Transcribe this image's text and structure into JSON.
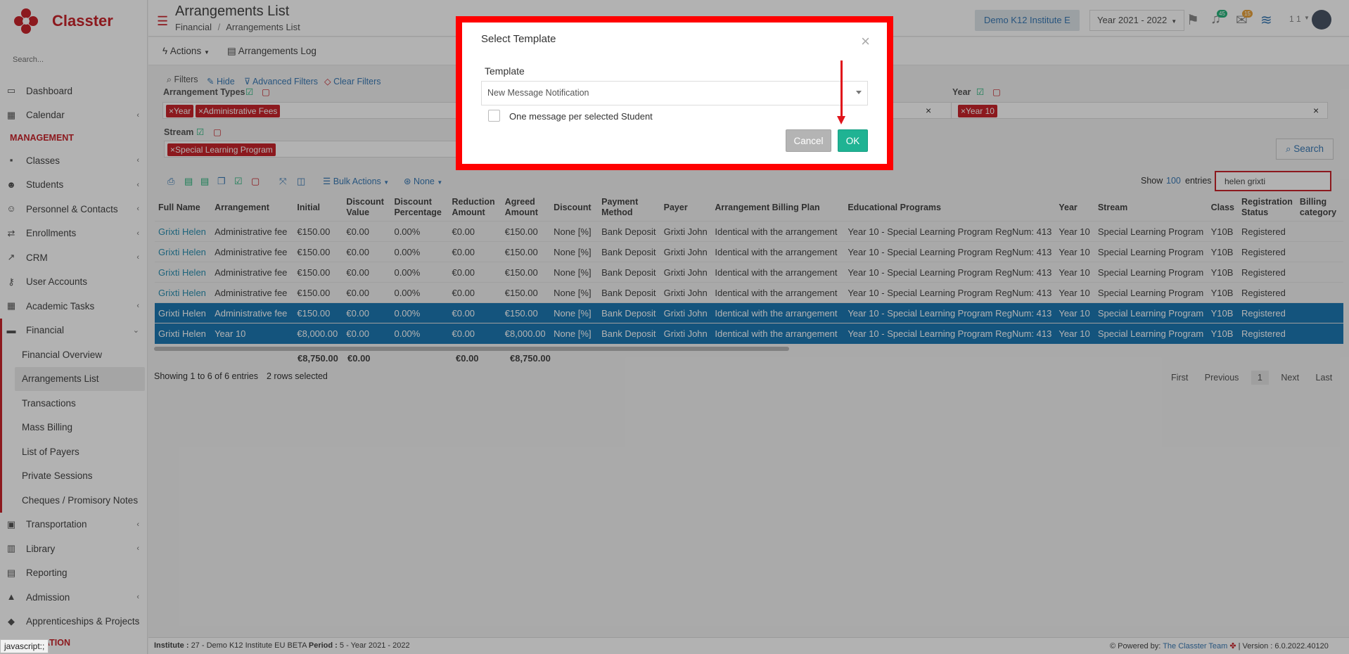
{
  "app": {
    "name": "Classter",
    "search_placeholder": "Search..."
  },
  "nav": {
    "dashboard": "Dashboard",
    "calendar": "Calendar",
    "management": "MANAGEMENT",
    "classes": "Classes",
    "students": "Students",
    "personnel": "Personnel & Contacts",
    "enrollments": "Enrollments",
    "crm": "CRM",
    "user_accounts": "User Accounts",
    "academic_tasks": "Academic Tasks",
    "financial": "Financial",
    "financial_overview": "Financial Overview",
    "arrangements_list": "Arrangements List",
    "transactions": "Transactions",
    "mass_billing": "Mass Billing",
    "list_of_payers": "List of Payers",
    "private_sessions": "Private Sessions",
    "cheques": "Cheques / Promisory Notes",
    "transportation": "Transportation",
    "library": "Library",
    "reporting": "Reporting",
    "admission": "Admission",
    "apprenticeships": "Apprenticeships & Projects",
    "configuration_partial": "URATION"
  },
  "header": {
    "title": "Arrangements List",
    "breadcrumb_1": "Financial",
    "breadcrumb_sep": "/",
    "breadcrumb_2": "Arrangements List",
    "institute": "Demo K12 Institute E",
    "year": "Year 2021 - 2022",
    "notif_count_1": "45",
    "notif_count_2": "15",
    "user_short": "1 1"
  },
  "toolbar": {
    "actions": "Actions",
    "log": "Arrangements Log"
  },
  "filters": {
    "filters": "Filters",
    "hide": "Hide",
    "advanced": "Advanced Filters",
    "clear": "Clear Filters",
    "arr_types_label": "Arrangement Types",
    "tag_year": "Year",
    "tag_admin": "Administrative Fees",
    "year_label": "Year",
    "tag_year10": "Year 10",
    "stream_label": "Stream",
    "tag_stream": "Special Learning Program",
    "search_btn": "Search",
    "tag_x": "×",
    "close_x": "×"
  },
  "table_controls": {
    "bulk": "Bulk Actions",
    "none": "None",
    "show": "Show",
    "entries_count": "100",
    "entries": "entries",
    "search_value": "helen grixti"
  },
  "table": {
    "headers": [
      "Full Name",
      "Arrangement",
      "Initial",
      "Discount Value",
      "Discount Percentage",
      "Reduction Amount",
      "Agreed Amount",
      "Discount",
      "Payment Method",
      "Payer",
      "Arrangement Billing Plan",
      "Educational Programs",
      "Year",
      "Stream",
      "Class",
      "Registration Status",
      "Billing category"
    ],
    "rows": [
      [
        "Grixti Helen",
        "Administrative fee",
        "€150.00",
        "€0.00",
        "0.00%",
        "€0.00",
        "€150.00",
        "None [%]",
        "Bank Deposit",
        "Grixti John",
        "Identical with the arrangement",
        "Year 10 - Special Learning Program RegNum: 413",
        "Year 10",
        "Special Learning Program",
        "Y10B",
        "Registered",
        ""
      ],
      [
        "Grixti Helen",
        "Administrative fee",
        "€150.00",
        "€0.00",
        "0.00%",
        "€0.00",
        "€150.00",
        "None [%]",
        "Bank Deposit",
        "Grixti John",
        "Identical with the arrangement",
        "Year 10 - Special Learning Program RegNum: 413",
        "Year 10",
        "Special Learning Program",
        "Y10B",
        "Registered",
        ""
      ],
      [
        "Grixti Helen",
        "Administrative fee",
        "€150.00",
        "€0.00",
        "0.00%",
        "€0.00",
        "€150.00",
        "None [%]",
        "Bank Deposit",
        "Grixti John",
        "Identical with the arrangement",
        "Year 10 - Special Learning Program RegNum: 413",
        "Year 10",
        "Special Learning Program",
        "Y10B",
        "Registered",
        ""
      ],
      [
        "Grixti Helen",
        "Administrative fee",
        "€150.00",
        "€0.00",
        "0.00%",
        "€0.00",
        "€150.00",
        "None [%]",
        "Bank Deposit",
        "Grixti John",
        "Identical with the arrangement",
        "Year 10 - Special Learning Program RegNum: 413",
        "Year 10",
        "Special Learning Program",
        "Y10B",
        "Registered",
        ""
      ],
      [
        "Grixti Helen",
        "Administrative fee",
        "€150.00",
        "€0.00",
        "0.00%",
        "€0.00",
        "€150.00",
        "None [%]",
        "Bank Deposit",
        "Grixti John",
        "Identical with the arrangement",
        "Year 10 - Special Learning Program RegNum: 413",
        "Year 10",
        "Special Learning Program",
        "Y10B",
        "Registered",
        ""
      ],
      [
        "Grixti Helen",
        "Year 10",
        "€8,000.00",
        "€0.00",
        "0.00%",
        "€0.00",
        "€8,000.00",
        "None [%]",
        "Bank Deposit",
        "Grixti John",
        "Identical with the arrangement",
        "Year 10 - Special Learning Program RegNum: 413",
        "Year 10",
        "Special Learning Program",
        "Y10B",
        "Registered",
        ""
      ]
    ],
    "selected_rows": [
      4,
      5
    ],
    "totals": {
      "initial": "€8,750.00",
      "discount": "€0.00",
      "reduction": "€0.00",
      "agreed": "€8,750.00"
    }
  },
  "pagination": {
    "info": "Showing 1 to 6 of 6 entries",
    "selected": "2 rows selected",
    "first": "First",
    "previous": "Previous",
    "page": "1",
    "next": "Next",
    "last": "Last"
  },
  "footer": {
    "inst_label": "Institute :",
    "inst_value": "27 - Demo K12 Institute EU BETA",
    "period_label": "Period :",
    "period_value": "5 - Year 2021 - 2022",
    "powered": "Powered by:",
    "team": "The Classter Team",
    "version": "| Version : 6.0.2022.40120"
  },
  "modal": {
    "title": "Select Template",
    "close": "×",
    "template_label": "Template",
    "template_value": "New Message Notification",
    "checkbox_label": "One message per selected Student",
    "cancel": "Cancel",
    "ok": "OK"
  },
  "tooltip": "javascript:;",
  "colors": {
    "brand": "#c9252c",
    "selected_row": "#1d79b4",
    "ok_button": "#1fb393",
    "highlight": "#ff0000"
  },
  "icons": [
    "search-icon",
    "hamburger-icon",
    "flag-icon",
    "bell-icon",
    "mail-icon",
    "layers-icon",
    "close-icon",
    "chevron-down-icon",
    "checkbox-icon",
    "print-icon",
    "filter-icon"
  ]
}
